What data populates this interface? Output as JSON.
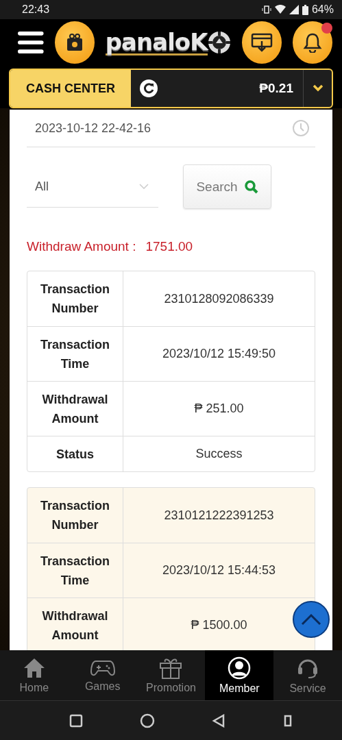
{
  "status_bar": {
    "time": "22:43",
    "battery": "64%"
  },
  "header": {
    "logo": "panaloK"
  },
  "cash_center": {
    "label": "CASH CENTER",
    "balance": "₱0.21"
  },
  "filters": {
    "date": "2023-10-12 22-42-16",
    "type": "All",
    "search": "Search"
  },
  "total": {
    "label": "Withdraw Amount :",
    "value": "1751.00"
  },
  "records": [
    {
      "rows": [
        {
          "label": "Transaction Number",
          "value": "2310128092086339"
        },
        {
          "label": "Transaction Time",
          "value": "2023/10/12 15:49:50"
        },
        {
          "label": "Withdrawal Amount",
          "value": "₱ 251.00"
        },
        {
          "label": "Status",
          "value": "Success"
        }
      ]
    },
    {
      "rows": [
        {
          "label": "Transaction Number",
          "value": "2310121222391253"
        },
        {
          "label": "Transaction Time",
          "value": "2023/10/12 15:44:53"
        },
        {
          "label": "Withdrawal Amount",
          "value": "₱ 1500.00"
        }
      ]
    }
  ],
  "nav": [
    {
      "label": "Home",
      "kind": "home",
      "selected": false
    },
    {
      "label": "Games",
      "kind": "games",
      "selected": false
    },
    {
      "label": "Promotion",
      "kind": "promotion",
      "selected": false
    },
    {
      "label": "Member",
      "kind": "member",
      "selected": true
    },
    {
      "label": "Service",
      "kind": "service",
      "selected": false
    }
  ]
}
